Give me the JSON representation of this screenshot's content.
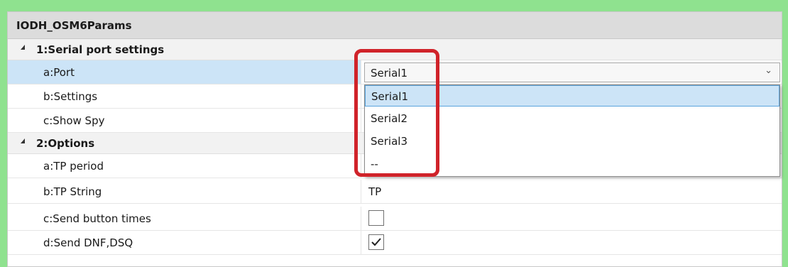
{
  "panel": {
    "title": "IODH_OSM6Params"
  },
  "categories": [
    {
      "label": "1:Serial port settings"
    },
    {
      "label": "2:Options"
    }
  ],
  "properties": {
    "port": {
      "name": "a:Port",
      "value": "Serial1"
    },
    "settings": {
      "name": "b:Settings"
    },
    "show_spy": {
      "name": "c:Show Spy"
    },
    "tp_period": {
      "name": "a:TP period"
    },
    "tp_string": {
      "name": "b:TP String",
      "value": "TP"
    },
    "send_button_times": {
      "name": "c:Send button times",
      "checked": false
    },
    "send_dnf_dsq": {
      "name": "d:Send DNF,DSQ",
      "checked": true
    }
  },
  "dropdown": {
    "options": [
      "Serial1",
      "Serial2",
      "Serial3",
      "--"
    ],
    "selected": "Serial1"
  },
  "colors": {
    "background": "#8fe28f",
    "selection": "#cce4f7",
    "annotation": "#d0232a"
  },
  "icons": {
    "expand": "triangle-collapse-icon",
    "combo": "chevron-down-icon",
    "check": "checkmark-icon"
  }
}
